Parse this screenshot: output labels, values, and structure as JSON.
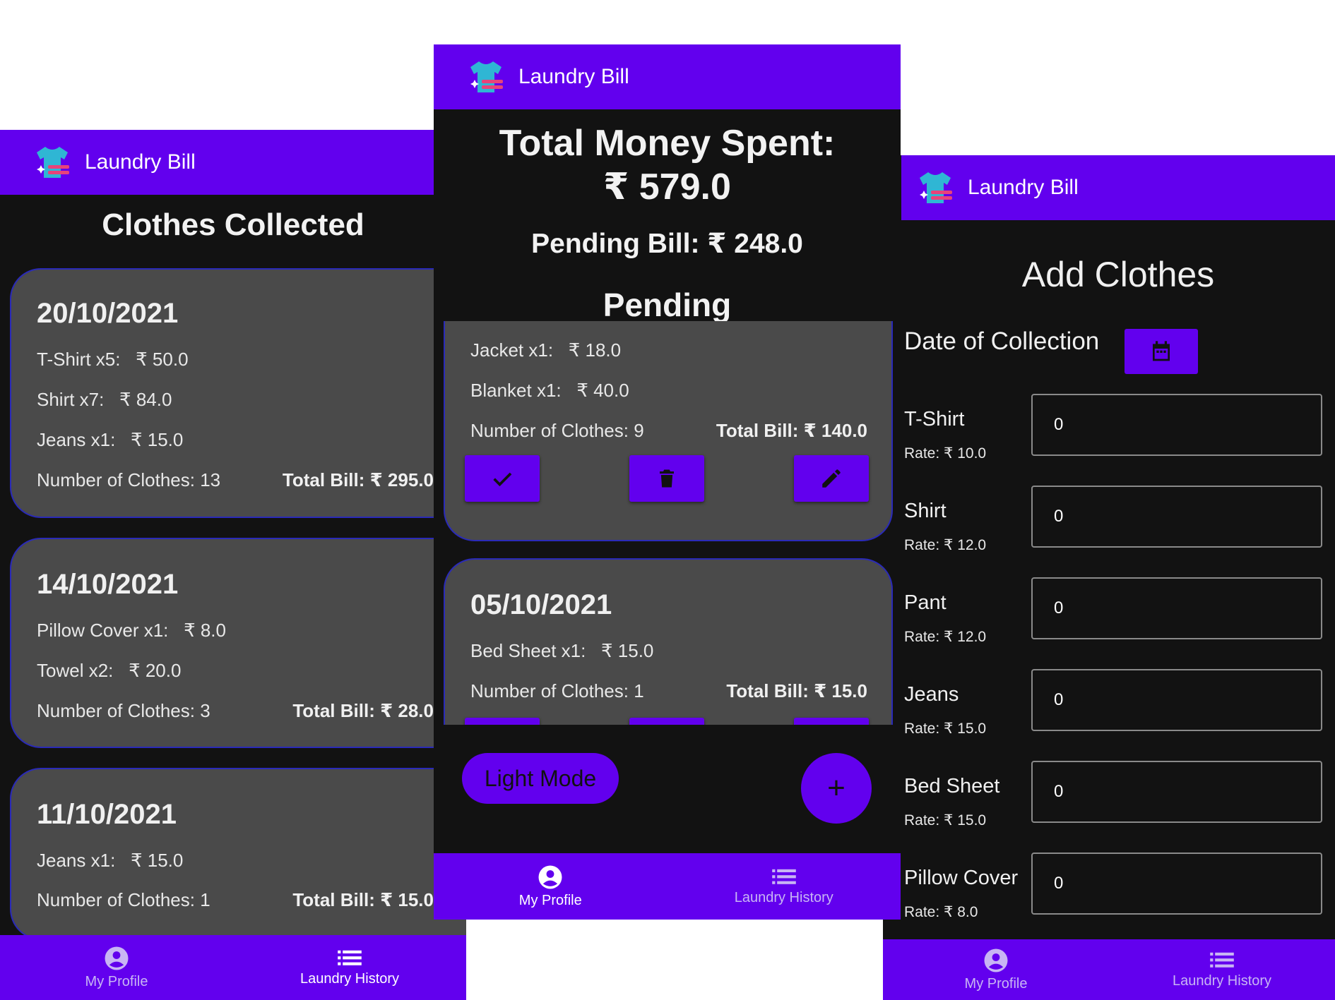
{
  "app": {
    "title": "Laundry Bill"
  },
  "colors": {
    "primary": "#6200ee",
    "background": "#121212",
    "card": "#4a4a4a",
    "card_border": "#2a2ab8"
  },
  "nav": {
    "profile_label": "My Profile",
    "history_label": "Laundry History",
    "profile_icon": "account-circle-icon",
    "history_icon": "list-icon"
  },
  "history_screen": {
    "heading": "Clothes Collected",
    "cards": [
      {
        "date": "20/10/2021",
        "items": [
          {
            "label": "T-Shirt x5:",
            "price": "₹ 50.0"
          },
          {
            "label": "Shirt x7:",
            "price": "₹ 84.0"
          },
          {
            "label": "Jeans x1:",
            "price": "₹ 15.0"
          }
        ],
        "count": "Number of Clothes: 13",
        "total": "Total Bill: ₹ 295.0"
      },
      {
        "date": "14/10/2021",
        "items": [
          {
            "label": "Pillow Cover x1:",
            "price": "₹ 8.0"
          },
          {
            "label": "Towel x2:",
            "price": "₹ 20.0"
          }
        ],
        "count": "Number of Clothes: 3",
        "total": "Total Bill: ₹ 28.0"
      },
      {
        "date": "11/10/2021",
        "items": [
          {
            "label": "Jeans x1:",
            "price": "₹ 15.0"
          }
        ],
        "count": "Number of Clothes: 1",
        "total": "Total Bill: ₹ 15.0"
      }
    ]
  },
  "profile_screen": {
    "total_label": "Total Money Spent:",
    "total_value": "₹ 579.0",
    "pending_bill": "Pending Bill: ₹ 248.0",
    "pending_heading": "Pending",
    "card1": {
      "items": [
        {
          "label": "Jacket x1:",
          "price": "₹ 18.0"
        },
        {
          "label": "Blanket x1:",
          "price": "₹ 40.0"
        }
      ],
      "count": "Number of Clothes: 9",
      "total": "Total Bill: ₹ 140.0"
    },
    "card2": {
      "date": "05/10/2021",
      "items": [
        {
          "label": "Bed Sheet x1:",
          "price": "₹ 15.0"
        }
      ],
      "count": "Number of Clothes: 1",
      "total": "Total Bill: ₹ 15.0"
    },
    "light_mode_label": "Light Mode",
    "fab_label": "+"
  },
  "add_screen": {
    "heading": "Add Clothes",
    "date_label": "Date of Collection",
    "fields": [
      {
        "name": "T-Shirt",
        "rate": "Rate: ₹ 10.0",
        "value": "0"
      },
      {
        "name": "Shirt",
        "rate": "Rate: ₹ 12.0",
        "value": "0"
      },
      {
        "name": "Pant",
        "rate": "Rate: ₹ 12.0",
        "value": "0"
      },
      {
        "name": "Jeans",
        "rate": "Rate: ₹ 15.0",
        "value": "0"
      },
      {
        "name": "Bed Sheet",
        "rate": "Rate: ₹ 15.0",
        "value": "0"
      },
      {
        "name": "Pillow Cover",
        "rate": "Rate: ₹ 8.0",
        "value": "0"
      }
    ]
  }
}
